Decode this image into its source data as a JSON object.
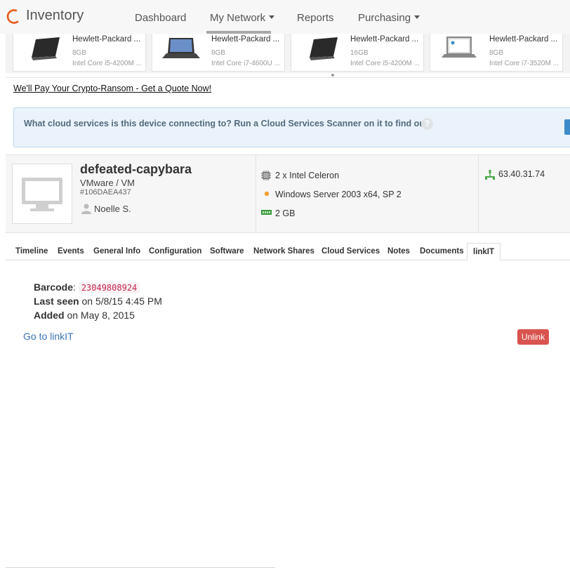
{
  "app": {
    "title": "Inventory"
  },
  "nav": {
    "items": [
      {
        "label": "Dashboard"
      },
      {
        "label": "My Network"
      },
      {
        "label": "Reports"
      },
      {
        "label": "Purchasing"
      }
    ],
    "active": "My Network"
  },
  "products": [
    {
      "name": "Hewlett-Packard ...",
      "ram": "8GB",
      "cpu": "Intel Core i5-4200M ..."
    },
    {
      "name": "Hewlett-Packard ...",
      "ram": "8GB",
      "cpu": "Intel Core i7-4600U ..."
    },
    {
      "name": "Hewlett-Packard ...",
      "ram": "16GB",
      "cpu": "Intel Core i5-4200M ..."
    },
    {
      "name": "Hewlett-Packard ...",
      "ram": "8GB",
      "cpu": "Intel Core i7-3520M ..."
    }
  ],
  "ad": {
    "text": "We'll Pay Your Crypto-Ransom - Get a Quote Now!"
  },
  "banner": {
    "text": "What cloud services is this device connecting to? Run a Cloud Services Scanner on it to find out.",
    "help": "?"
  },
  "device": {
    "name": "defeated-capybara",
    "type": "VMware / VM",
    "id": "#106DAEA437",
    "user": "Noelle S.",
    "cpu": "2 x Intel Celeron",
    "os": "Windows Server 2003 x64, SP 2",
    "ram": "2 GB",
    "ip": "63.40.31.74"
  },
  "tabs": [
    {
      "label": "Timeline"
    },
    {
      "label": "Events"
    },
    {
      "label": "General Info"
    },
    {
      "label": "Configuration"
    },
    {
      "label": "Software"
    },
    {
      "label": "Network Shares"
    },
    {
      "label": "Cloud Services"
    },
    {
      "label": "Notes"
    },
    {
      "label": "Documents"
    },
    {
      "label": "linkIT"
    }
  ],
  "active_tab": "linkIT",
  "linkit": {
    "barcode_label": "Barcode",
    "barcode": "23049808924",
    "last_seen_label": "Last seen",
    "last_seen": "on 5/8/15 4:45 PM",
    "added_label": "Added",
    "added": "on May 8, 2015",
    "goto": "Go to linkIT",
    "unlink": "Unlink"
  },
  "colors": {
    "brand_orange": "#e8591a",
    "link": "#3a74b4",
    "danger": "#d9534f",
    "banner_bg": "#eaf3fb",
    "barcode": "#c7254e"
  },
  "icons": {
    "logo": "logo-icon",
    "cpu": "cpu-icon",
    "os": "os-dot-icon",
    "ram": "ram-icon",
    "network": "network-icon",
    "user": "user-icon",
    "device": "monitor-icon"
  }
}
